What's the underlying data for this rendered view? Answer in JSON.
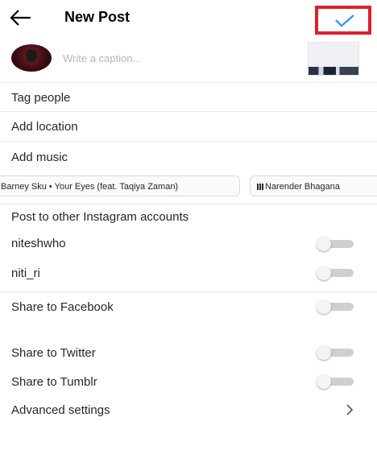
{
  "header": {
    "title": "New Post",
    "back_icon": "arrow-left-icon",
    "confirm_icon": "checkmark-icon",
    "accent": "#3897f0",
    "highlight": "#e01e2b"
  },
  "caption": {
    "placeholder": "Write a caption...",
    "value": ""
  },
  "options": {
    "tag_people": "Tag people",
    "add_location": "Add location",
    "add_music": "Add music"
  },
  "music_chips": [
    {
      "text": "Barney Sku • Your Eyes (feat. Taqiya Zaman)"
    },
    {
      "text": "Narender Bhagana"
    }
  ],
  "other_accounts": {
    "heading": "Post to other Instagram accounts",
    "accounts": [
      {
        "name": "niteshwho",
        "enabled": false
      },
      {
        "name": "niti_ri",
        "enabled": false
      }
    ]
  },
  "share": [
    {
      "label": "Share to Facebook",
      "enabled": false
    },
    {
      "label": "Share to Twitter",
      "enabled": false
    },
    {
      "label": "Share to Tumblr",
      "enabled": false
    }
  ],
  "advanced": {
    "label": "Advanced settings",
    "icon": "chevron-right-icon"
  }
}
